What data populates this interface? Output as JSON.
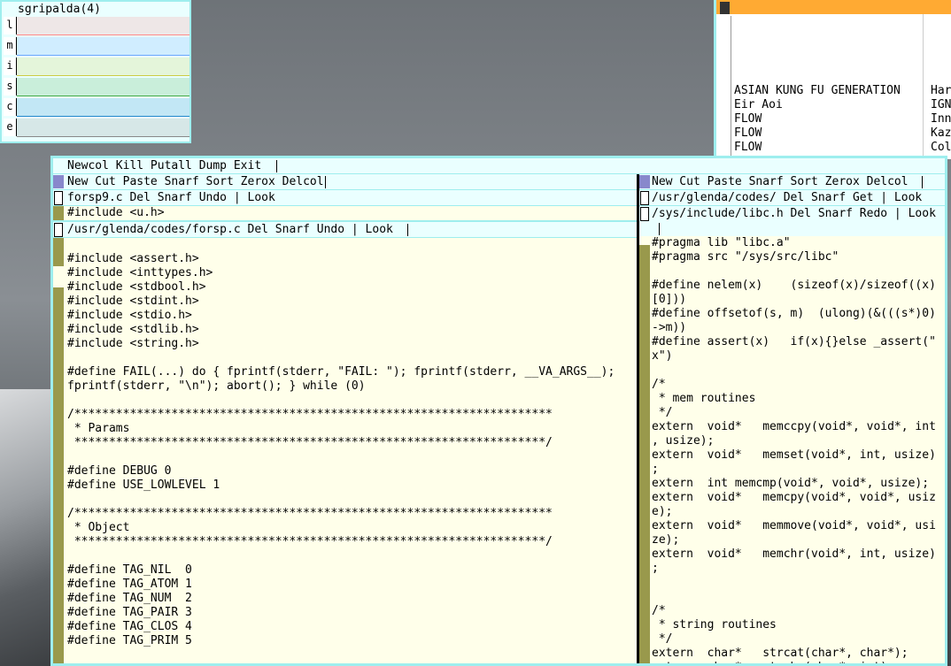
{
  "stats": {
    "title": "sgripalda(4)",
    "rows": [
      {
        "label": "l",
        "color": "#ff8888"
      },
      {
        "label": "m",
        "color": "#6aa6ff"
      },
      {
        "label": "i",
        "color": "#cccc44"
      },
      {
        "label": "s",
        "color": "#44aa44"
      },
      {
        "label": "c",
        "color": "#2288cc"
      },
      {
        "label": "e",
        "color": "#888888"
      }
    ]
  },
  "music": {
    "col1": [
      "ASIAN KUNG FU GENERATION",
      "Eir Aoi",
      "FLOW",
      "FLOW",
      "FLOW"
    ],
    "col2": [
      "Hard",
      "IGN",
      "Inne",
      "Kazu",
      "Colo"
    ]
  },
  "acme": {
    "main_tag": "Newcol Kill Putall Dump Exit",
    "left_column": {
      "tag": "New Cut Paste Snarf Sort Zerox Delcol",
      "win1_tag": "forsp9.c Del Snarf Undo | Look",
      "win1_body": "#include <u.h>",
      "win2_tag": "/usr/glenda/codes/forsp.c Del Snarf Undo | Look",
      "lines": [
        "",
        "#include <assert.h>",
        "#include <inttypes.h>",
        "#include <stdbool.h>",
        "#include <stdint.h>",
        "#include <stdio.h>",
        "#include <stdlib.h>",
        "#include <string.h>",
        "",
        "#define FAIL(...) do { fprintf(stderr, \"FAIL: \"); fprintf(stderr, __VA_ARGS__);",
        "fprintf(stderr, \"\\n\"); abort(); } while (0)",
        "",
        "/*********************************************************************",
        " * Params",
        " ********************************************************************/",
        "",
        "#define DEBUG 0",
        "#define USE_LOWLEVEL 1",
        "",
        "/*********************************************************************",
        " * Object",
        " ********************************************************************/",
        "",
        "#define TAG_NIL  0",
        "#define TAG_ATOM 1",
        "#define TAG_NUM  2",
        "#define TAG_PAIR 3",
        "#define TAG_CLOS 4",
        "#define TAG_PRIM 5"
      ]
    },
    "right_column": {
      "tag": "New Cut Paste Snarf Sort Zerox Delcol",
      "win1_tag": "/usr/glenda/codes/ Del Snarf Get | Look",
      "win2_tag": "/sys/include/libc.h Del Snarf Redo | Look",
      "lines": [
        "#pragma lib \"libc.a\"",
        "#pragma src \"/sys/src/libc\"",
        "",
        "#define nelem(x)    (sizeof(x)/sizeof((x)",
        "[0]))",
        "#define offsetof(s, m)  (ulong)(&(((s*)0)",
        "->m))",
        "#define assert(x)   if(x){}else _assert(\"",
        "x\")",
        "",
        "/*",
        " * mem routines",
        " */",
        "extern  void*   memccpy(void*, void*, int",
        ", usize);",
        "extern  void*   memset(void*, int, usize)",
        ";",
        "extern  int memcmp(void*, void*, usize);",
        "extern  void*   memcpy(void*, void*, usiz",
        "e);",
        "extern  void*   memmove(void*, void*, usi",
        "ze);",
        "extern  void*   memchr(void*, int, usize)",
        ";",
        "",
        "",
        "/*",
        " * string routines",
        " */",
        "extern  char*   strcat(char*, char*);",
        "extern  char*   strchr(char*, int);"
      ]
    }
  }
}
